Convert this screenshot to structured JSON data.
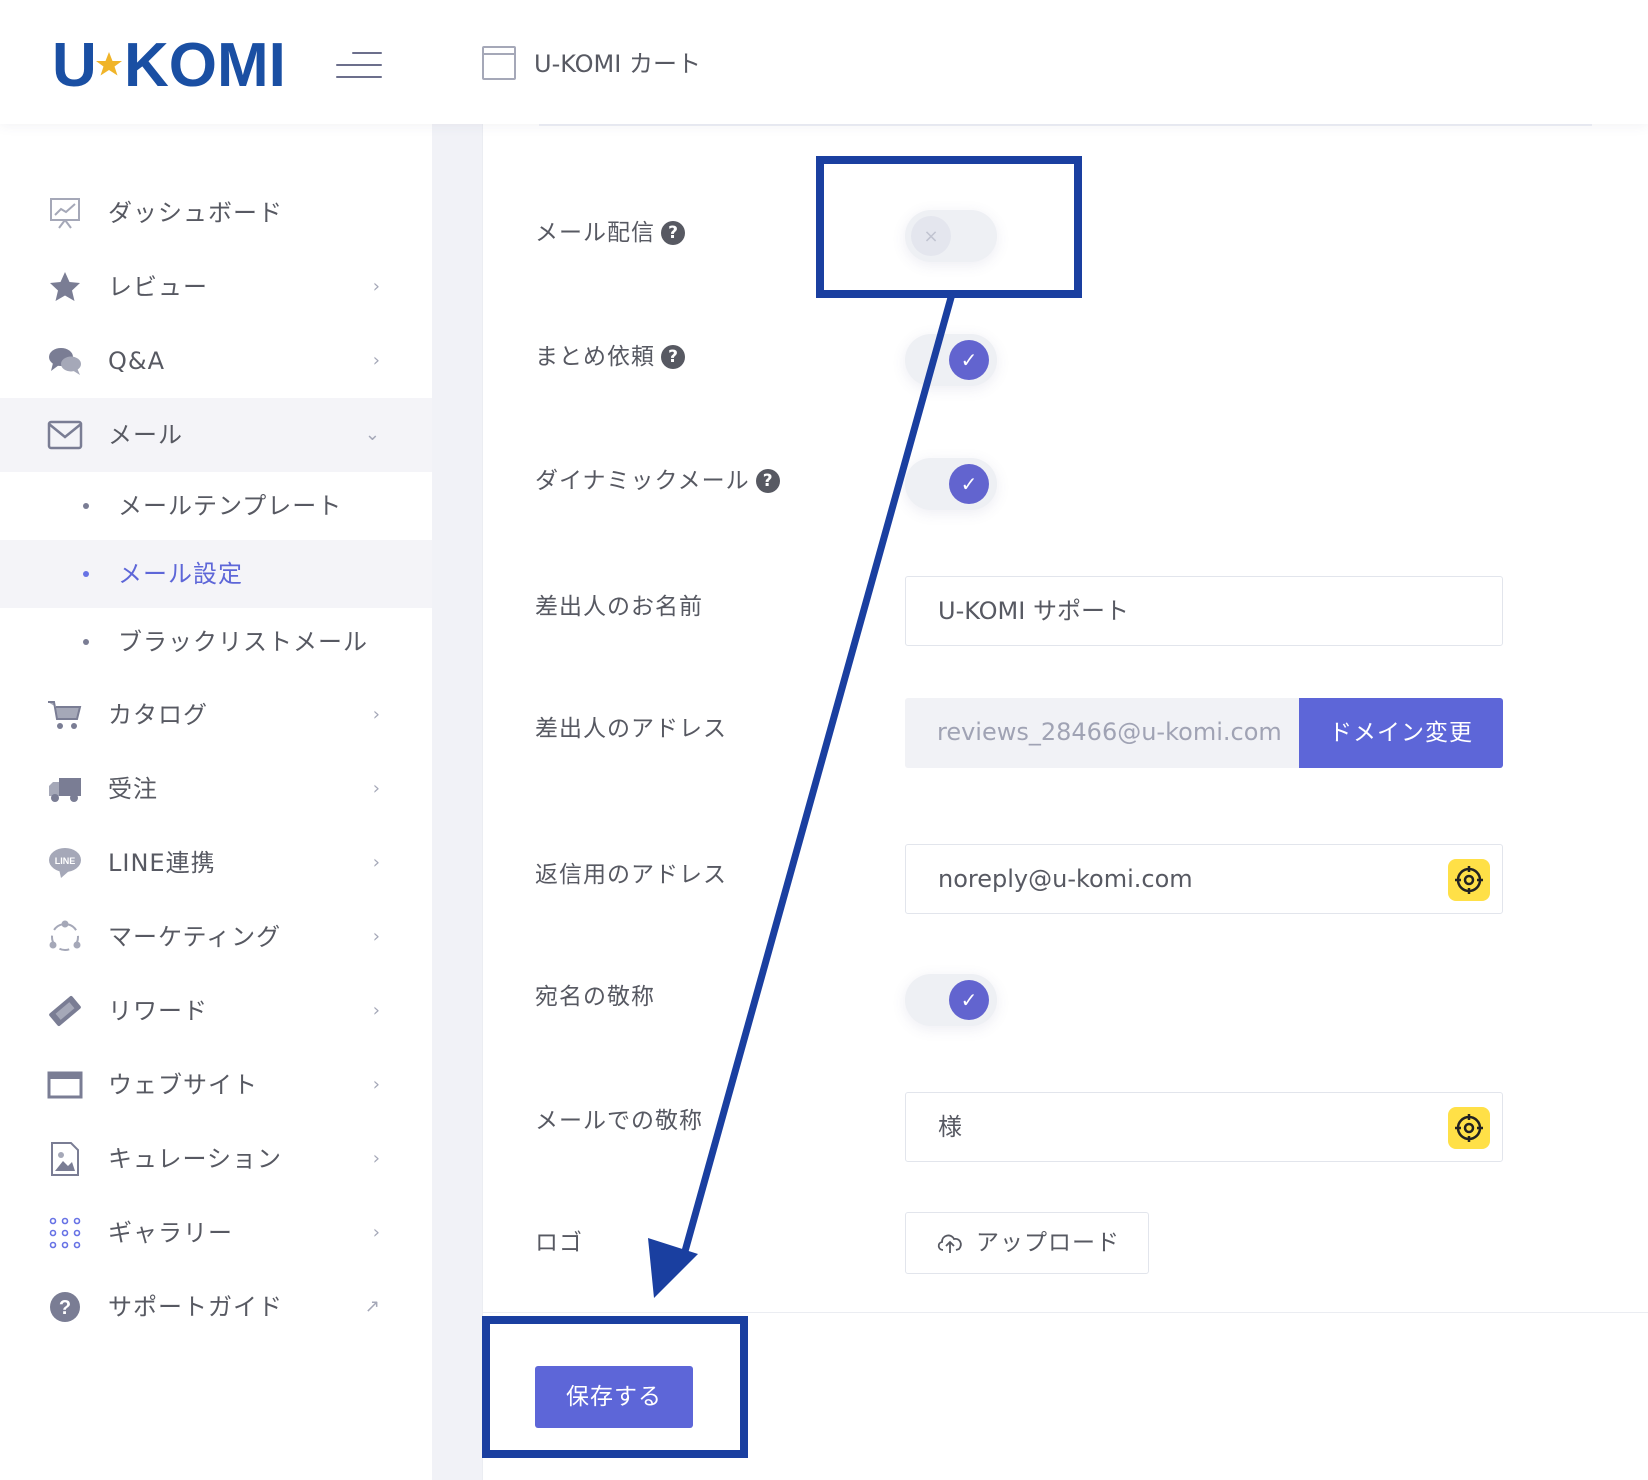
{
  "brand": {
    "logo_left": "U",
    "logo_right": "KOMI",
    "colors": {
      "logo_blue": "#1a4fa3",
      "logo_star": "#f0b429",
      "accent": "#5d66d8",
      "toggle_on": "#6264cf",
      "highlight_yellow": "#ffe047",
      "annotation_blue": "#1a3fa0"
    }
  },
  "header": {
    "title": "U-KOMI カート",
    "menu_icon": "hamburger-icon",
    "window_icon": "window-icon"
  },
  "sidebar": {
    "items": [
      {
        "label": "ダッシュボード",
        "icon": "chart-board-icon"
      },
      {
        "label": "レビュー",
        "icon": "star-icon",
        "arrow": "›"
      },
      {
        "label": "Q&A",
        "icon": "chat-bubbles-icon",
        "arrow": "›"
      },
      {
        "label": "メール",
        "icon": "envelope-icon",
        "arrow": "⌄"
      },
      {
        "label": "カタログ",
        "icon": "cart-icon",
        "arrow": "›"
      },
      {
        "label": "受注",
        "icon": "truck-icon",
        "arrow": "›"
      },
      {
        "label": "LINE連携",
        "icon": "line-icon",
        "icon_text": "LINE",
        "arrow": "›"
      },
      {
        "label": "マーケティング",
        "icon": "network-icon",
        "arrow": "›"
      },
      {
        "label": "リワード",
        "icon": "ticket-icon",
        "arrow": "›"
      },
      {
        "label": "ウェブサイト",
        "icon": "browser-icon",
        "arrow": "›"
      },
      {
        "label": "キュレーション",
        "icon": "image-file-icon",
        "arrow": "›"
      },
      {
        "label": "ギャラリー",
        "icon": "dots-grid-icon",
        "arrow": "›"
      },
      {
        "label": "サポートガイド",
        "icon": "question-circle-icon",
        "arrow": "↗"
      }
    ],
    "mail_sub": [
      {
        "label": "メールテンプレート"
      },
      {
        "label": "メール設定"
      },
      {
        "label": "ブラックリストメール"
      }
    ]
  },
  "form": {
    "mail_delivery": {
      "label": "メール配信",
      "help": "?",
      "enabled": false,
      "knob_off": "×"
    },
    "summary_request": {
      "label": "まとめ依頼",
      "help": "?",
      "enabled": true,
      "knob_on": "✓"
    },
    "dynamic_mail": {
      "label": "ダイナミックメール",
      "help": "?",
      "enabled": true,
      "knob_on": "✓"
    },
    "sender_name": {
      "label": "差出人のお名前",
      "value": "U-KOMI サポート"
    },
    "sender_address": {
      "label": "差出人のアドレス",
      "value": "reviews_28466@u-komi.com",
      "button": "ドメイン変更"
    },
    "reply_address": {
      "label": "返信用のアドレス",
      "value": "noreply@u-komi.com"
    },
    "recipient_honorific": {
      "label": "宛名の敬称",
      "enabled": true,
      "knob_on": "✓"
    },
    "mail_honorific": {
      "label": "メールでの敬称",
      "value": "様"
    },
    "logo": {
      "label": "ロゴ",
      "button": "アップロード"
    },
    "save_button": "保存する"
  }
}
